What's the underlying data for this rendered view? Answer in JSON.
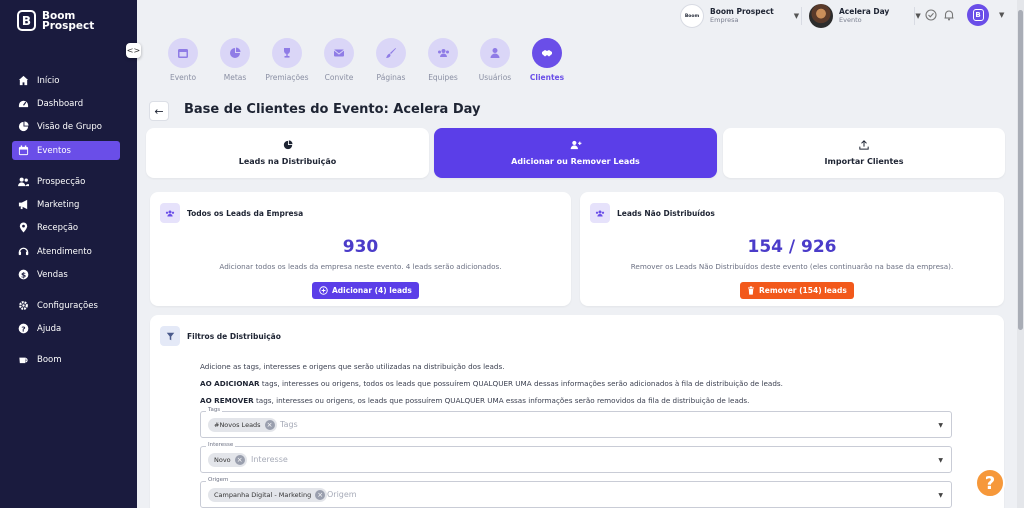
{
  "brand": {
    "line1": "Boom",
    "line2": "Prospect",
    "mark": "B"
  },
  "sidebar": {
    "items": [
      {
        "label": "Início",
        "icon": "home-icon"
      },
      {
        "label": "Dashboard",
        "icon": "dashboard-icon"
      },
      {
        "label": "Visão de Grupo",
        "icon": "pie-chart-icon"
      },
      {
        "label": "Eventos",
        "icon": "calendar-icon",
        "active": true
      },
      {
        "label": "Prospecção",
        "icon": "users-icon"
      },
      {
        "label": "Marketing",
        "icon": "megaphone-icon"
      },
      {
        "label": "Recepção",
        "icon": "location-pin-icon"
      },
      {
        "label": "Atendimento",
        "icon": "headset-icon"
      },
      {
        "label": "Vendas",
        "icon": "dollar-icon"
      },
      {
        "label": "Configurações",
        "icon": "gear-icon"
      },
      {
        "label": "Ajuda",
        "icon": "help-icon"
      },
      {
        "label": "Boom",
        "icon": "coffee-icon"
      }
    ]
  },
  "header": {
    "company": {
      "name": "Boom Prospect",
      "sub": "Empresa"
    },
    "event": {
      "name": "Acelera Day",
      "sub": "Evento"
    }
  },
  "tabs": [
    {
      "label": "Evento",
      "icon": "calendar-icon"
    },
    {
      "label": "Metas",
      "icon": "pie-chart-icon"
    },
    {
      "label": "Premiações",
      "icon": "trophy-icon"
    },
    {
      "label": "Convite",
      "icon": "envelope-icon"
    },
    {
      "label": "Páginas",
      "icon": "brush-icon"
    },
    {
      "label": "Equipes",
      "icon": "team-icon"
    },
    {
      "label": "Usuários",
      "icon": "user-icon"
    },
    {
      "label": "Clientes",
      "icon": "handshake-icon",
      "active": true
    }
  ],
  "page": {
    "title": "Base de Clientes do Evento: Acelera Day"
  },
  "actions": {
    "distribution": "Leads na Distribuição",
    "add_remove": "Adicionar ou Remover Leads",
    "import": "Importar Clientes"
  },
  "company_leads": {
    "title": "Todos os Leads da Empresa",
    "count": "930",
    "desc": "Adicionar todos os leads da empresa neste evento. 4 leads serão adicionados.",
    "button": "Adicionar (4) leads"
  },
  "undistributed": {
    "title": "Leads Não Distribuídos",
    "count": "154 / 926",
    "desc": "Remover os Leads Não Distribuídos deste evento (eles continuarão na base da empresa).",
    "button": "Remover (154) leads"
  },
  "filters": {
    "title": "Filtros de Distribuição",
    "intro": "Adicione as tags, interesses e origens que serão utilizadas na distribuição dos leads.",
    "add_strong": "AO ADICIONAR",
    "add_rest": " tags, interesses ou origens, todos os leads que possuírem QUALQUER UMA dessas informações serão adicionados à fila de distribuição de leads.",
    "remove_strong": "AO REMOVER",
    "remove_rest": " tags, interesses ou origens, os leads que possuírem QUALQUER UMA essas informações serão removidos da fila de distribuição de leads.",
    "tags": {
      "label": "Tags",
      "chip": "#Novos Leads",
      "placeholder": "Tags"
    },
    "interest": {
      "label": "Interesse",
      "chip": "Novo",
      "placeholder": "Interesse"
    },
    "origin": {
      "label": "Origem",
      "chip": "Campanha Digital - Marketing",
      "placeholder": "Origem"
    }
  },
  "colors": {
    "primary": "#5b3ee8",
    "sidebar": "#1a1b3e",
    "danger": "#f2591b",
    "help": "#f6983a"
  }
}
